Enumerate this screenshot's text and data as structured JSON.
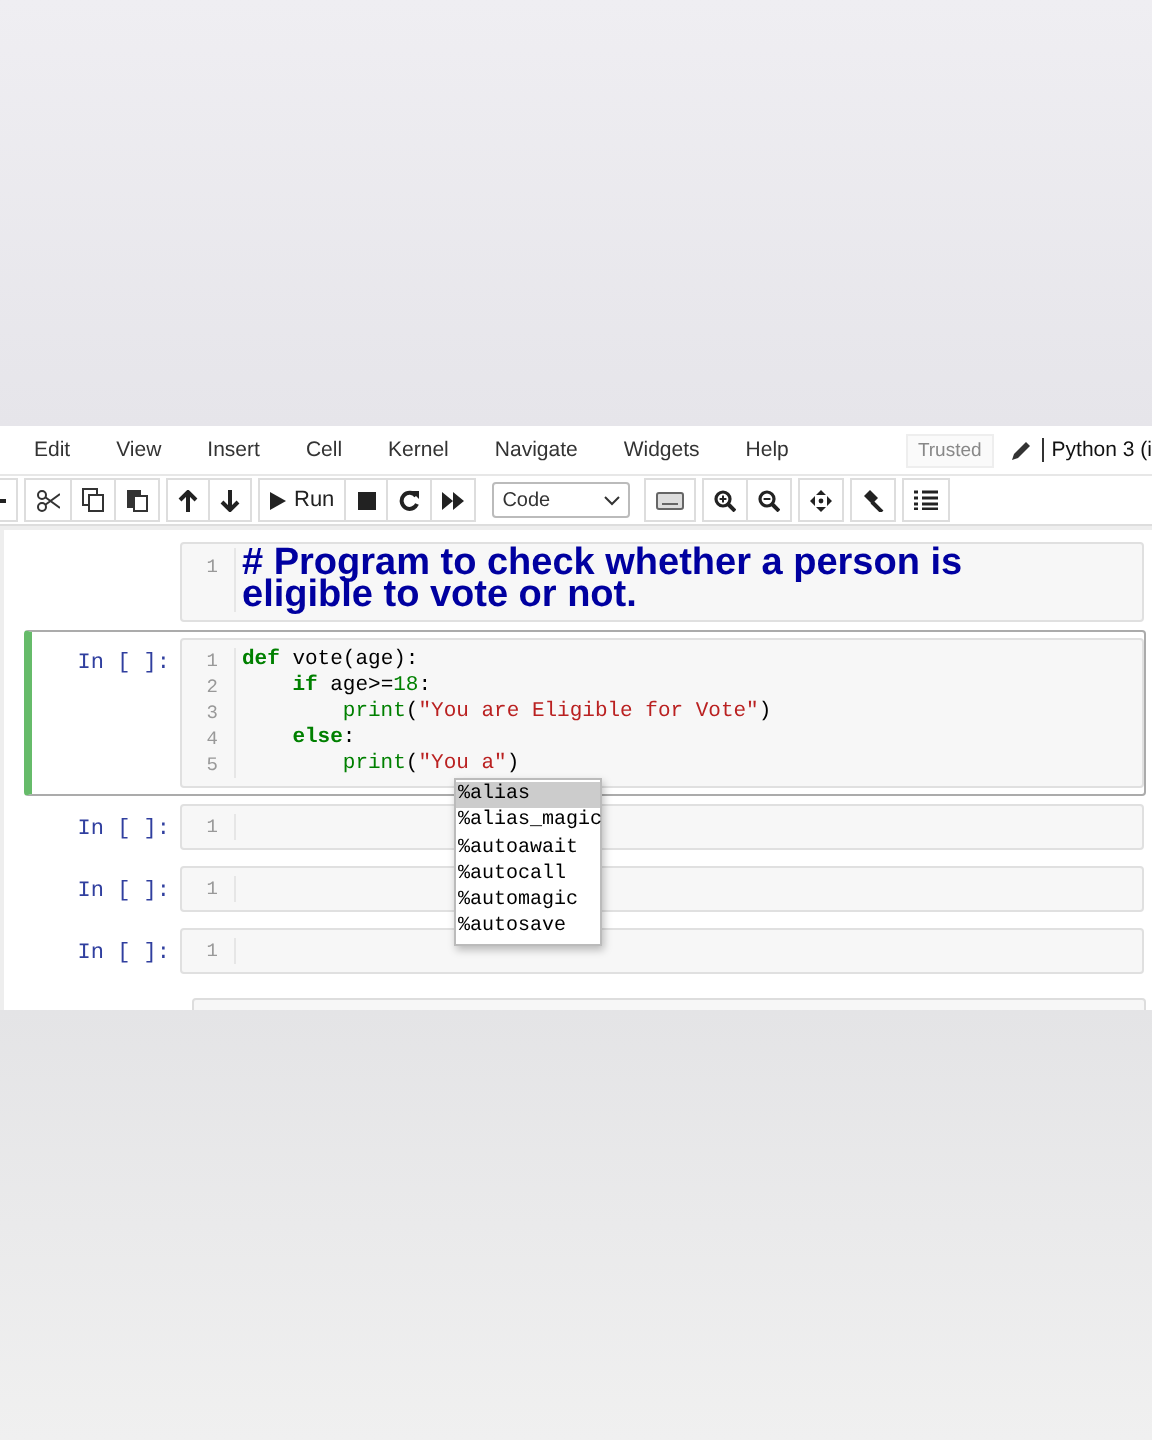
{
  "menu": {
    "items": [
      "Edit",
      "View",
      "Insert",
      "Cell",
      "Kernel",
      "Navigate",
      "Widgets",
      "Help"
    ],
    "trusted": "Trusted",
    "kernel": "Python 3 (i"
  },
  "toolbar": {
    "run_label": "Run",
    "cell_type": "Code"
  },
  "cells": [
    {
      "kind": "markdown",
      "selected": false,
      "lines": [
        {
          "number": "1",
          "tokens": [
            {
              "kind": "heading",
              "text": "# Program to check whether a person is eligible to vote or not."
            }
          ]
        }
      ]
    },
    {
      "kind": "code",
      "selected": true,
      "prompt": "In [ ]:",
      "lines": [
        {
          "number": "1",
          "tokens": [
            {
              "kind": "keyword",
              "text": "def"
            },
            {
              "kind": "plain",
              "text": " vote(age):"
            }
          ]
        },
        {
          "number": "2",
          "tokens": [
            {
              "kind": "keyword",
              "text": "    if"
            },
            {
              "kind": "plain",
              "text": " age>="
            },
            {
              "kind": "number",
              "text": "18"
            },
            {
              "kind": "plain",
              "text": ":"
            }
          ]
        },
        {
          "number": "3",
          "tokens": [
            {
              "kind": "builtin",
              "text": "        print"
            },
            {
              "kind": "plain",
              "text": "("
            },
            {
              "kind": "string",
              "text": "\"You are Eligible for Vote\""
            },
            {
              "kind": "plain",
              "text": ")"
            }
          ]
        },
        {
          "number": "4",
          "tokens": [
            {
              "kind": "keyword",
              "text": "    else"
            },
            {
              "kind": "plain",
              "text": ":"
            }
          ]
        },
        {
          "number": "5",
          "tokens": [
            {
              "kind": "builtin",
              "text": "        print"
            },
            {
              "kind": "plain",
              "text": "("
            },
            {
              "kind": "string",
              "text": "\"You a\""
            },
            {
              "kind": "plain",
              "text": ")"
            }
          ]
        }
      ]
    },
    {
      "kind": "code",
      "selected": false,
      "prompt": "In [ ]:",
      "lines": [
        {
          "number": "1"
        }
      ]
    },
    {
      "kind": "code",
      "selected": false,
      "prompt": "In [ ]:",
      "lines": [
        {
          "number": "1"
        }
      ]
    },
    {
      "kind": "code",
      "selected": false,
      "prompt": "In [ ]:",
      "lines": [
        {
          "number": "1"
        }
      ]
    }
  ],
  "completer": {
    "items": [
      {
        "label": "%alias",
        "selected": true
      },
      {
        "label": "%alias_magic",
        "selected": false
      },
      {
        "label": "%autoawait",
        "selected": false
      },
      {
        "label": "%autocall",
        "selected": false
      },
      {
        "label": "%automagic",
        "selected": false
      },
      {
        "label": "%autosave",
        "selected": false
      }
    ]
  }
}
